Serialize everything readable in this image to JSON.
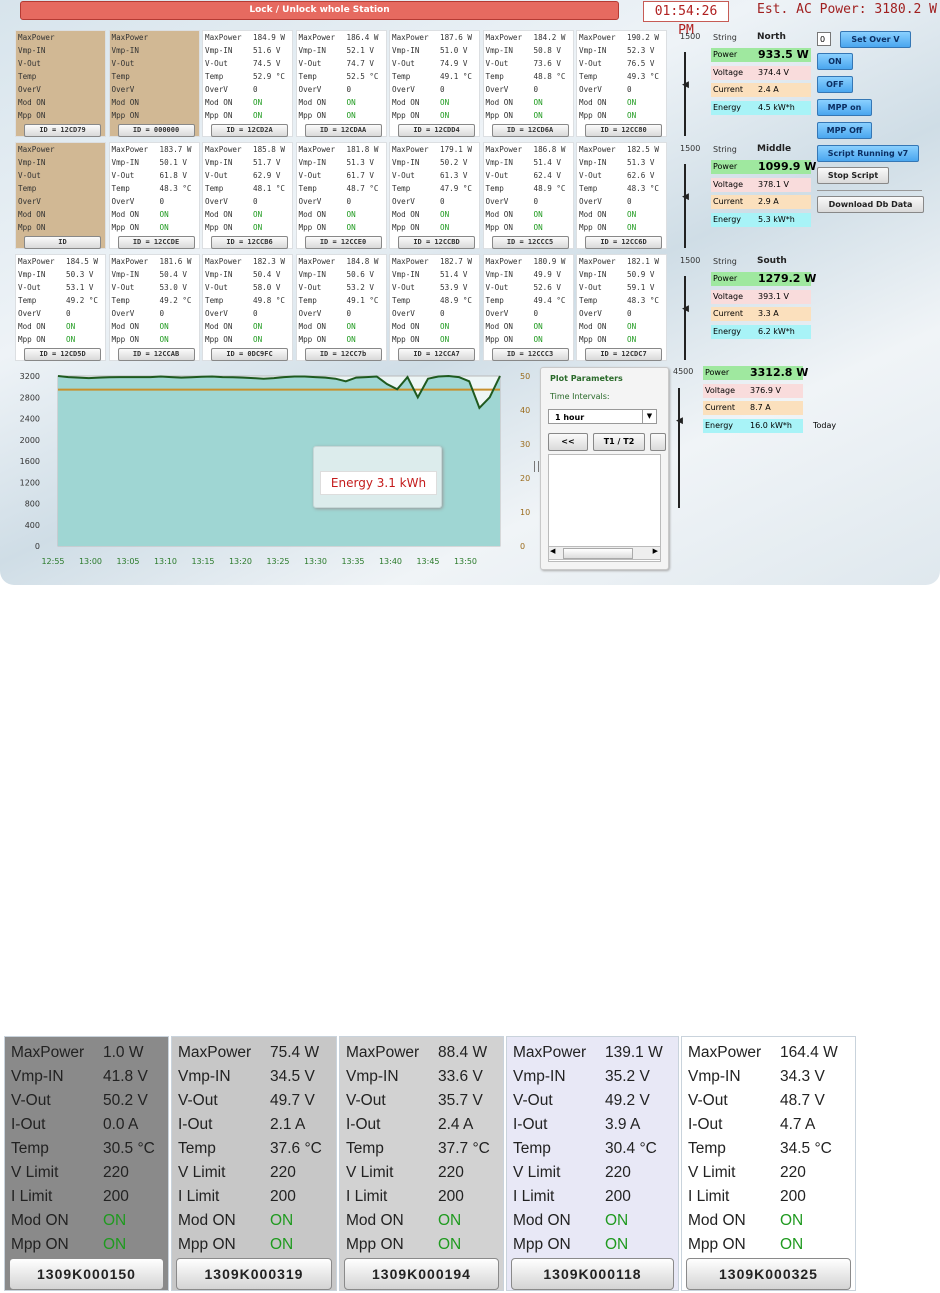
{
  "header": {
    "lock_label": "Lock / Unlock whole Station",
    "time": "01:54:26 PM",
    "ac_power": "Est. AC Power: 3180.2 W"
  },
  "labels": {
    "maxpower": "MaxPower",
    "vmp": "Vmp-IN",
    "vout": "V-Out",
    "temp": "Temp",
    "overv": "OverV",
    "modon": "Mod ON",
    "mppon": "Mpp ON"
  },
  "rows": [
    [
      {
        "tan": true,
        "maxpower": "",
        "vmp": "",
        "vout": "",
        "temp": "",
        "overv": "",
        "modon": "",
        "mppon": "",
        "id": "ID = 12CD79"
      },
      {
        "tan": true,
        "maxpower": "",
        "vmp": "",
        "vout": "",
        "temp": "",
        "overv": "",
        "modon": "",
        "mppon": "",
        "id": "ID = 000000"
      },
      {
        "maxpower": "184.9 W",
        "vmp": "51.6 V",
        "vout": "74.5 V",
        "temp": "52.9 °C",
        "overv": "0",
        "modon": "ON",
        "mppon": "ON",
        "id": "ID = 12CD2A"
      },
      {
        "maxpower": "186.4 W",
        "vmp": "52.1 V",
        "vout": "74.7 V",
        "temp": "52.5 °C",
        "overv": "0",
        "modon": "ON",
        "mppon": "ON",
        "id": "ID = 12CDAA"
      },
      {
        "maxpower": "187.6 W",
        "vmp": "51.0 V",
        "vout": "74.9 V",
        "temp": "49.1 °C",
        "overv": "0",
        "modon": "ON",
        "mppon": "ON",
        "id": "ID = 12CDD4"
      },
      {
        "maxpower": "184.2 W",
        "vmp": "50.8 V",
        "vout": "73.6 V",
        "temp": "48.8 °C",
        "overv": "0",
        "modon": "ON",
        "mppon": "ON",
        "id": "ID = 12CD6A"
      },
      {
        "maxpower": "190.2 W",
        "vmp": "52.3 V",
        "vout": "76.5 V",
        "temp": "49.3 °C",
        "overv": "0",
        "modon": "ON",
        "mppon": "ON",
        "id": "ID = 12CC80"
      }
    ],
    [
      {
        "tan": true,
        "maxpower": "",
        "vmp": "",
        "vout": "",
        "temp": "",
        "overv": "",
        "modon": "",
        "mppon": "",
        "id": "ID"
      },
      {
        "maxpower": "183.7 W",
        "vmp": "50.1 V",
        "vout": "61.8 V",
        "temp": "48.3 °C",
        "overv": "0",
        "modon": "ON",
        "mppon": "ON",
        "id": "ID = 12CCDE"
      },
      {
        "maxpower": "185.8 W",
        "vmp": "51.7 V",
        "vout": "62.9 V",
        "temp": "48.1 °C",
        "overv": "0",
        "modon": "ON",
        "mppon": "ON",
        "id": "ID = 12CCB6"
      },
      {
        "maxpower": "181.8 W",
        "vmp": "51.3 V",
        "vout": "61.7 V",
        "temp": "48.7 °C",
        "overv": "0",
        "modon": "ON",
        "mppon": "ON",
        "id": "ID = 12CCE0"
      },
      {
        "maxpower": "179.1 W",
        "vmp": "50.2 V",
        "vout": "61.3 V",
        "temp": "47.9 °C",
        "overv": "0",
        "modon": "ON",
        "mppon": "ON",
        "id": "ID = 12CCBD"
      },
      {
        "maxpower": "186.8 W",
        "vmp": "51.4 V",
        "vout": "62.4 V",
        "temp": "48.9 °C",
        "overv": "0",
        "modon": "ON",
        "mppon": "ON",
        "id": "ID = 12CCC5"
      },
      {
        "maxpower": "182.5 W",
        "vmp": "51.3 V",
        "vout": "62.6 V",
        "temp": "48.3 °C",
        "overv": "0",
        "modon": "ON",
        "mppon": "ON",
        "id": "ID = 12CC6D"
      }
    ],
    [
      {
        "maxpower": "184.5 W",
        "vmp": "50.3 V",
        "vout": "53.1 V",
        "temp": "49.2 °C",
        "overv": "0",
        "modon": "ON",
        "mppon": "ON",
        "id": "ID = 12CD5D"
      },
      {
        "maxpower": "181.6 W",
        "vmp": "50.4 V",
        "vout": "53.0 V",
        "temp": "49.2 °C",
        "overv": "0",
        "modon": "ON",
        "mppon": "ON",
        "id": "ID = 12CCAB"
      },
      {
        "maxpower": "182.3 W",
        "vmp": "50.4 V",
        "vout": "58.0 V",
        "temp": "49.8 °C",
        "overv": "0",
        "modon": "ON",
        "mppon": "ON",
        "id": "ID = 0DC9FC"
      },
      {
        "maxpower": "184.8 W",
        "vmp": "50.6 V",
        "vout": "53.2 V",
        "temp": "49.1 °C",
        "overv": "0",
        "modon": "ON",
        "mppon": "ON",
        "id": "ID = 12CC7b"
      },
      {
        "maxpower": "182.7 W",
        "vmp": "51.4 V",
        "vout": "53.9 V",
        "temp": "48.9 °C",
        "overv": "0",
        "modon": "ON",
        "mppon": "ON",
        "id": "ID = 12CCA7"
      },
      {
        "maxpower": "180.9 W",
        "vmp": "49.9 V",
        "vout": "52.6 V",
        "temp": "49.4 °C",
        "overv": "0",
        "modon": "ON",
        "mppon": "ON",
        "id": "ID = 12CCC3"
      },
      {
        "maxpower": "182.1 W",
        "vmp": "50.9 V",
        "vout": "59.1 V",
        "temp": "48.3 °C",
        "overv": "0",
        "modon": "ON",
        "mppon": "ON",
        "id": "ID = 12CDC7"
      }
    ]
  ],
  "strings": [
    {
      "scale": "1500",
      "label": "String",
      "name": "North",
      "power_label": "Power",
      "power": "933.5 W",
      "voltage_label": "Voltage",
      "voltage": "374.4 V",
      "current_label": "Current",
      "current": "2.4 A",
      "energy_label": "Energy",
      "energy": "4.5 kW*h"
    },
    {
      "scale": "1500",
      "label": "String",
      "name": "Middle",
      "power_label": "Power",
      "power": "1099.9 W",
      "voltage_label": "Voltage",
      "voltage": "378.1 V",
      "current_label": "Current",
      "current": "2.9 A",
      "energy_label": "Energy",
      "energy": "5.3 kW*h"
    },
    {
      "scale": "1500",
      "label": "String",
      "name": "South",
      "power_label": "Power",
      "power": "1279.2 W",
      "voltage_label": "Voltage",
      "voltage": "393.1 V",
      "current_label": "Current",
      "current": "3.3 A",
      "energy_label": "Energy",
      "energy": "6.2 kW*h"
    }
  ],
  "total": {
    "scale": "4500",
    "power_label": "Power",
    "power": "3312.8 W",
    "voltage_label": "Voltage",
    "voltage": "376.9 V",
    "current_label": "Current",
    "current": "8.7 A",
    "energy_label": "Energy",
    "energy": "16.0 kW*h",
    "today": "Today"
  },
  "controls": {
    "input_value": "0",
    "set_over_v": "Set Over V",
    "on": "ON",
    "off": "OFF",
    "mpp_on": "MPP on",
    "mpp_off": "MPP Off",
    "script_running": "Script Running v7",
    "stop_script": "Stop Script",
    "download": "Download Db Data"
  },
  "plot": {
    "title": "Plot Parameters",
    "time_intervals": "Time Intervals:",
    "interval": "1 hour",
    "back": "<<",
    "t1t2": "T1 / T2",
    "energy": "Energy 3.1 kWh"
  },
  "chart_data": {
    "type": "area",
    "x": [
      "12:55",
      "13:00",
      "13:05",
      "13:10",
      "13:15",
      "13:20",
      "13:25",
      "13:30",
      "13:35",
      "13:40",
      "13:45",
      "13:50"
    ],
    "ylim": [
      0,
      3200
    ],
    "y_ticks": [
      "3200",
      "2800",
      "2400",
      "2000",
      "1600",
      "1200",
      "800",
      "400",
      "0"
    ],
    "y2lim": [
      0,
      50
    ],
    "y2_ticks": [
      "50",
      "40",
      "30",
      "20",
      "10",
      "0"
    ],
    "colors": {
      "fill": "#9fd6d3",
      "line": "#1f5a1f",
      "line2": "#c8902c"
    },
    "series": [
      {
        "values": [
          3200,
          3180,
          3170,
          3160,
          3170,
          3175,
          3180,
          3180,
          3180,
          3180,
          3190,
          3180,
          3170,
          3175,
          3185,
          3190,
          3180,
          3175,
          3170,
          3160,
          3150,
          3160,
          3180,
          3190,
          3190,
          3180,
          3170,
          3150,
          3100,
          3170,
          3180,
          3190,
          3050,
          2950,
          3180,
          2800,
          3150,
          3190,
          3200,
          3180,
          3100,
          2600,
          2800,
          3200
        ]
      },
      {
        "values": [
          46,
          46,
          46,
          46,
          46,
          46,
          46,
          46,
          46,
          46,
          46,
          46,
          46,
          46,
          46,
          46,
          46,
          46,
          46,
          46,
          46,
          46,
          46,
          46,
          46,
          46,
          46,
          46,
          46,
          46,
          46,
          46,
          46,
          46,
          46,
          46,
          46,
          46,
          46,
          46,
          46,
          46,
          46,
          46
        ]
      }
    ]
  },
  "bottom_labels": {
    "maxpower": "MaxPower",
    "vmp": "Vmp-IN",
    "vout": "V-Out",
    "iout": "I-Out",
    "temp": "Temp",
    "vlimit": "V Limit",
    "ilimit": "I Limit",
    "modon": "Mod ON",
    "mppon": "Mpp ON"
  },
  "bottom_cards": [
    {
      "bg": "#8a8a8a",
      "maxpower": "1.0 W",
      "vmp": "41.8 V",
      "vout": "50.2 V",
      "iout": "0.0 A",
      "temp": "30.5 °C",
      "vlimit": "220",
      "ilimit": "200",
      "modon": "ON",
      "mppon": "ON",
      "id": "1309K000150"
    },
    {
      "bg": "#c7c7c7",
      "maxpower": "75.4 W",
      "vmp": "34.5 V",
      "vout": "49.7 V",
      "iout": "2.1 A",
      "temp": "37.6 °C",
      "vlimit": "220",
      "ilimit": "200",
      "modon": "ON",
      "mppon": "ON",
      "id": "1309K000319"
    },
    {
      "bg": "#d2d2d2",
      "maxpower": "88.4 W",
      "vmp": "33.6 V",
      "vout": "35.7 V",
      "iout": "2.4 A",
      "temp": "37.7 °C",
      "vlimit": "220",
      "ilimit": "200",
      "modon": "ON",
      "mppon": "ON",
      "id": "1309K000194"
    },
    {
      "bg": "#e8e8f6",
      "maxpower": "139.1 W",
      "vmp": "35.2 V",
      "vout": "49.2 V",
      "iout": "3.9 A",
      "temp": "30.4 °C",
      "vlimit": "220",
      "ilimit": "200",
      "modon": "ON",
      "mppon": "ON",
      "id": "1309K000118"
    },
    {
      "bg": "#ffffff",
      "maxpower": "164.4 W",
      "vmp": "34.3 V",
      "vout": "48.7 V",
      "iout": "4.7 A",
      "temp": "34.5 °C",
      "vlimit": "220",
      "ilimit": "200",
      "modon": "ON",
      "mppon": "ON",
      "id": "1309K000325"
    }
  ]
}
